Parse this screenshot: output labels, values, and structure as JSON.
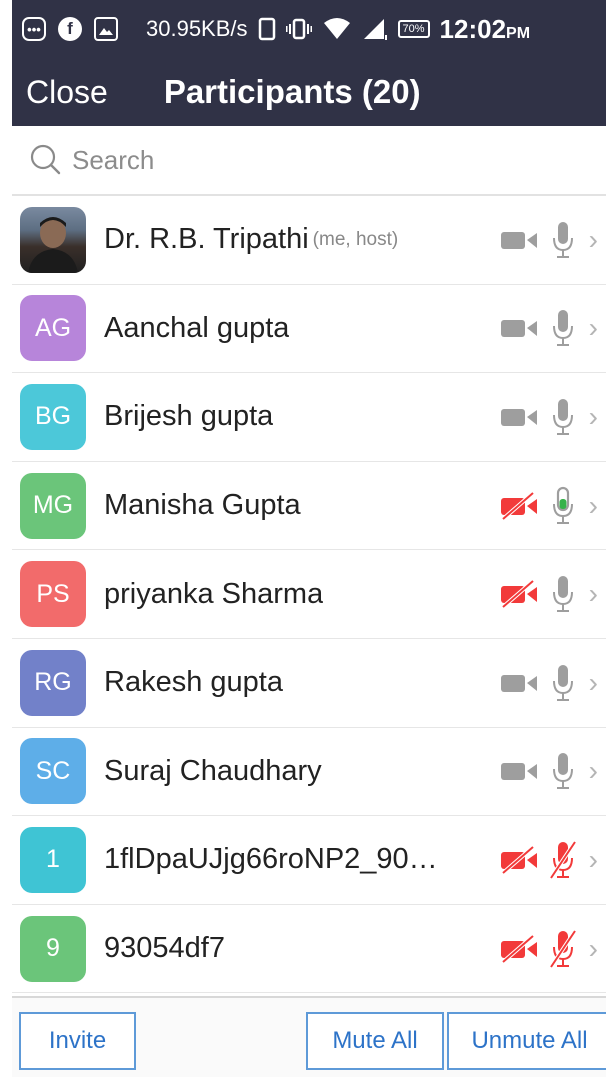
{
  "status_bar": {
    "network_speed": "30.95KB/s",
    "battery": "70%",
    "time": "12:02",
    "ampm": "PM",
    "icons": [
      "chat-icon",
      "facebook-icon",
      "gallery-icon",
      "phone-icon",
      "vibrate-icon",
      "wifi-icon",
      "signal-icon",
      "battery-icon"
    ]
  },
  "header": {
    "close_label": "Close",
    "title": "Participants (20)"
  },
  "search": {
    "placeholder": "Search"
  },
  "colors": {
    "header_bg": "#303246",
    "muted_red": "#f23a3a",
    "unmuted_green": "#36b24a",
    "icon_gray": "#9e9e9e",
    "button_blue": "#2d73c8"
  },
  "participants": [
    {
      "name": "Dr. R.B. Tripathi",
      "tag": "(me, host)",
      "initials": "",
      "avatar_color": "#5d6e82",
      "photo": true,
      "video_off": false,
      "mic_state": "normal"
    },
    {
      "name": "Aanchal gupta",
      "tag": "",
      "initials": "AG",
      "avatar_color": "#b785da",
      "photo": false,
      "video_off": false,
      "mic_state": "normal"
    },
    {
      "name": "Brijesh gupta",
      "tag": "",
      "initials": "BG",
      "avatar_color": "#4cc8d9",
      "photo": false,
      "video_off": false,
      "mic_state": "normal"
    },
    {
      "name": "Manisha Gupta",
      "tag": "",
      "initials": "MG",
      "avatar_color": "#6bc57a",
      "photo": false,
      "video_off": true,
      "mic_state": "active"
    },
    {
      "name": "priyanka Sharma",
      "tag": "",
      "initials": "PS",
      "avatar_color": "#f26b6b",
      "photo": false,
      "video_off": true,
      "mic_state": "normal"
    },
    {
      "name": "Rakesh gupta",
      "tag": "",
      "initials": "RG",
      "avatar_color": "#7281c9",
      "photo": false,
      "video_off": false,
      "mic_state": "normal"
    },
    {
      "name": "Suraj Chaudhary",
      "tag": "",
      "initials": "SC",
      "avatar_color": "#5eaee8",
      "photo": false,
      "video_off": false,
      "mic_state": "normal"
    },
    {
      "name": "1flDpaUJjg66roNP2_90…",
      "tag": "",
      "initials": "1",
      "avatar_color": "#3fc4d4",
      "photo": false,
      "video_off": true,
      "mic_state": "muted"
    },
    {
      "name": "93054df7",
      "tag": "",
      "initials": "9",
      "avatar_color": "#6bc57a",
      "photo": false,
      "video_off": true,
      "mic_state": "muted"
    }
  ],
  "footer": {
    "invite_label": "Invite",
    "mute_all_label": "Mute All",
    "unmute_all_label": "Unmute All"
  }
}
